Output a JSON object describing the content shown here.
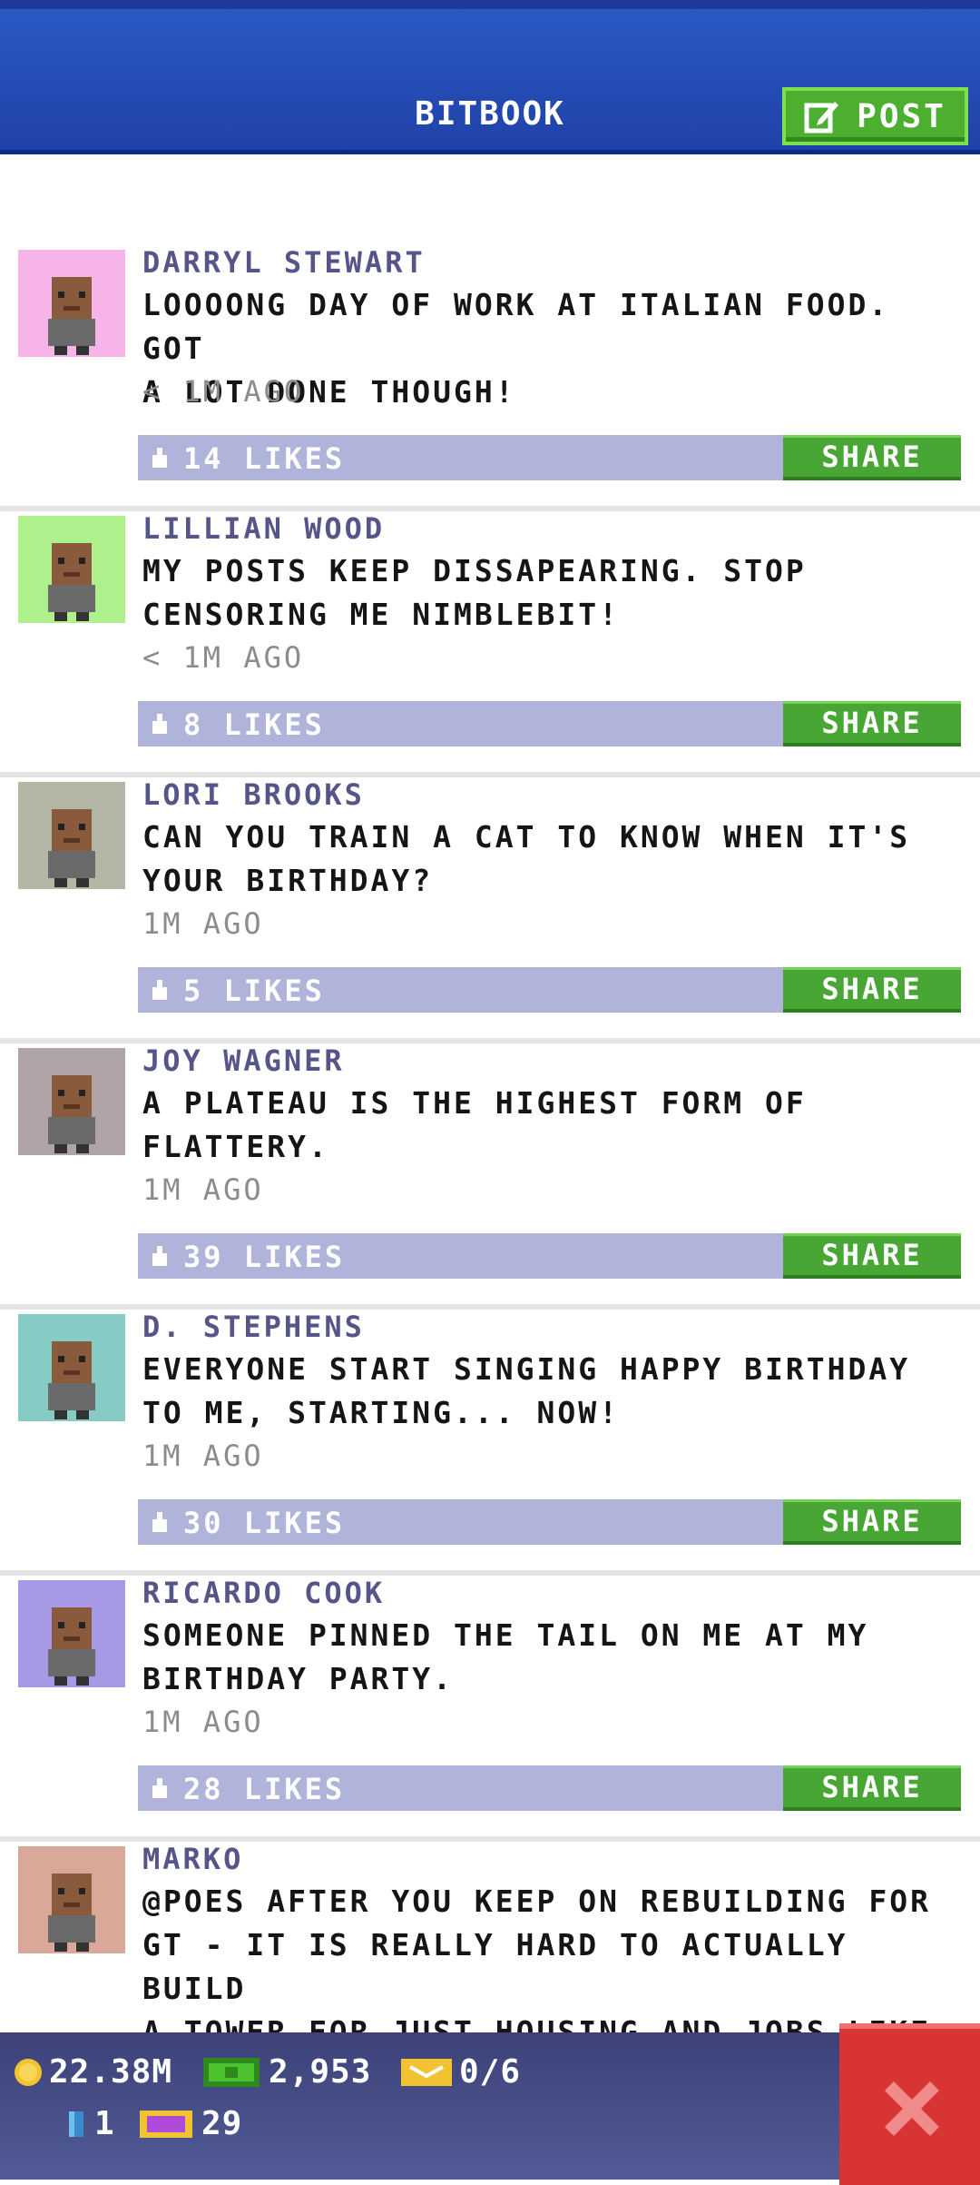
{
  "header": {
    "title": "BITBOOK",
    "post_label": "POST"
  },
  "posts": [
    {
      "author": "DARRYL STEWART",
      "message": "LOOOONG DAY OF WORK AT ITALIAN FOOD. GOT\nA LOT DONE THOUGH!",
      "time": "< 1M AGO",
      "likes": "14 LIKES",
      "share": "SHARE",
      "avatar_bg": "#f7b4e8"
    },
    {
      "author": "LILLIAN WOOD",
      "message": "MY POSTS KEEP DISSAPEARING. STOP\nCENSORING ME NIMBLEBIT!",
      "time": "< 1M AGO",
      "likes": "8 LIKES",
      "share": "SHARE",
      "avatar_bg": "#aef08c"
    },
    {
      "author": "LORI BROOKS",
      "message": "CAN YOU TRAIN A CAT TO KNOW WHEN IT'S\nYOUR BIRTHDAY?",
      "time": "1M AGO",
      "likes": "5 LIKES",
      "share": "SHARE",
      "avatar_bg": "#b4b6a6"
    },
    {
      "author": "JOY WAGNER",
      "message": "A PLATEAU IS THE HIGHEST FORM OF\nFLATTERY.",
      "time": "1M AGO",
      "likes": "39 LIKES",
      "share": "SHARE",
      "avatar_bg": "#b0a4a6"
    },
    {
      "author": "D. STEPHENS",
      "message": "EVERYONE START SINGING HAPPY BIRTHDAY\nTO ME, STARTING... NOW!",
      "time": "1M AGO",
      "likes": "30 LIKES",
      "share": "SHARE",
      "avatar_bg": "#86ccc4"
    },
    {
      "author": "RICARDO COOK",
      "message": "SOMEONE PINNED THE TAIL ON ME AT MY\nBIRTHDAY PARTY.",
      "time": "1M AGO",
      "likes": "28 LIKES",
      "share": "SHARE",
      "avatar_bg": "#a899e6"
    },
    {
      "author": "MARKO",
      "message": "@POES AFTER YOU KEEP ON REBUILDING FOR\nGT - IT IS REALLY HARD TO ACTUALLY BUILD\nA TOWER FOR JUST HOUSING AND JOBS LIKE\nBEFORE",
      "time": "",
      "likes": "",
      "share": "",
      "avatar_bg": "#d9a898"
    }
  ],
  "footer": {
    "coins": "22.38M",
    "bux": "2,953",
    "tickets": "0/6",
    "keys": "1",
    "tokens": "29"
  },
  "icons": {
    "post": "edit-icon",
    "like": "thumbs-up-icon",
    "coin": "coin-icon",
    "bux": "bux-icon",
    "ticket": "ticket-icon",
    "key": "key-icon",
    "token": "token-icon",
    "close": "close-icon"
  }
}
